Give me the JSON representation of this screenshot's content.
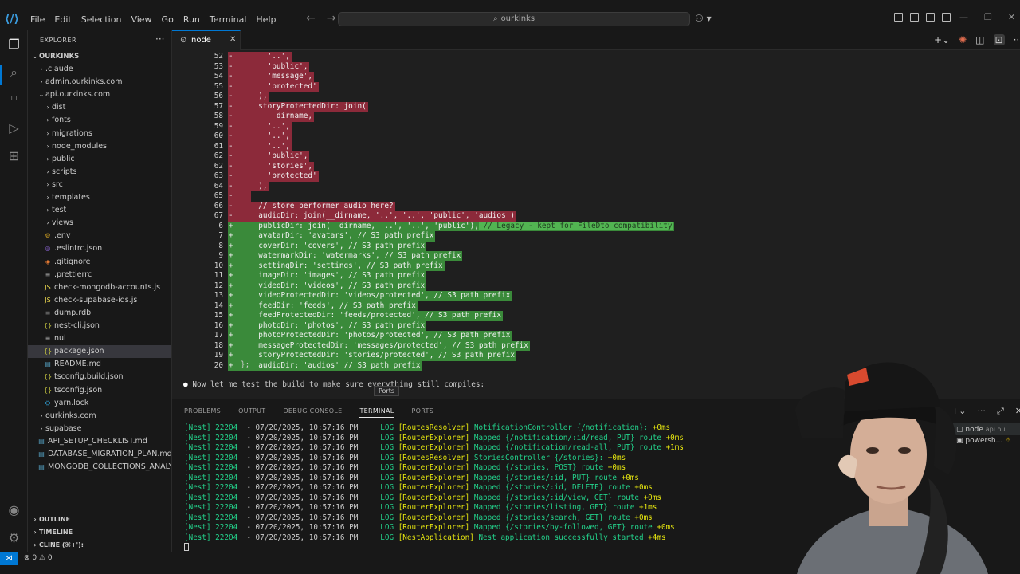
{
  "titlebar": {
    "menu": [
      "File",
      "Edit",
      "Selection",
      "View",
      "Go",
      "Run",
      "Terminal",
      "Help"
    ],
    "search_text": "ourkinks"
  },
  "sidebar": {
    "header": "EXPLORER",
    "root": "OURKINKS",
    "items": [
      {
        "label": ".claude",
        "type": "folder",
        "depth": 1
      },
      {
        "label": "admin.ourkinks.com",
        "type": "folder",
        "depth": 1
      },
      {
        "label": "api.ourkinks.com",
        "type": "folder-open",
        "depth": 1
      },
      {
        "label": "dist",
        "type": "folder",
        "depth": 2
      },
      {
        "label": "fonts",
        "type": "folder",
        "depth": 2
      },
      {
        "label": "migrations",
        "type": "folder",
        "depth": 2
      },
      {
        "label": "node_modules",
        "type": "folder",
        "depth": 2
      },
      {
        "label": "public",
        "type": "folder",
        "depth": 2
      },
      {
        "label": "scripts",
        "type": "folder",
        "depth": 2
      },
      {
        "label": "src",
        "type": "folder",
        "depth": 2
      },
      {
        "label": "templates",
        "type": "folder",
        "depth": 2
      },
      {
        "label": "test",
        "type": "folder",
        "depth": 2
      },
      {
        "label": "views",
        "type": "folder",
        "depth": 2
      },
      {
        "label": ".env",
        "type": "file-gear",
        "depth": 2
      },
      {
        "label": ".eslintrc.json",
        "type": "file-eslint",
        "depth": 2
      },
      {
        "label": ".gitignore",
        "type": "file-git",
        "depth": 2
      },
      {
        "label": ".prettierrc",
        "type": "file-text",
        "depth": 2
      },
      {
        "label": "check-mongodb-accounts.js",
        "type": "file-js",
        "depth": 2
      },
      {
        "label": "check-supabase-ids.js",
        "type": "file-js",
        "depth": 2
      },
      {
        "label": "dump.rdb",
        "type": "file-text",
        "depth": 2
      },
      {
        "label": "nest-cli.json",
        "type": "file-json",
        "depth": 2
      },
      {
        "label": "nul",
        "type": "file-text",
        "depth": 2
      },
      {
        "label": "package.json",
        "type": "file-json",
        "depth": 2,
        "selected": true
      },
      {
        "label": "README.md",
        "type": "file-md",
        "depth": 2
      },
      {
        "label": "tsconfig.build.json",
        "type": "file-json",
        "depth": 2
      },
      {
        "label": "tsconfig.json",
        "type": "file-json",
        "depth": 2
      },
      {
        "label": "yarn.lock",
        "type": "file-yarn",
        "depth": 2
      },
      {
        "label": "ourkinks.com",
        "type": "folder",
        "depth": 1
      },
      {
        "label": "supabase",
        "type": "folder",
        "depth": 1
      },
      {
        "label": "API_SETUP_CHECKLIST.md",
        "type": "file-md",
        "depth": 1
      },
      {
        "label": "DATABASE_MIGRATION_PLAN.md",
        "type": "file-md",
        "depth": 1
      },
      {
        "label": "MONGODB_COLLECTIONS_ANALY...",
        "type": "file-md",
        "depth": 1
      }
    ],
    "sections": [
      "OUTLINE",
      "TIMELINE",
      "CLINE (⌘+'):"
    ]
  },
  "tab": {
    "label": "node"
  },
  "diff": [
    {
      "ln": "52",
      "kind": "del",
      "code": "    '..',"
    },
    {
      "ln": "53",
      "kind": "del",
      "code": "    'public',"
    },
    {
      "ln": "54",
      "kind": "del",
      "code": "    'message',"
    },
    {
      "ln": "55",
      "kind": "del",
      "code": "    'protected'"
    },
    {
      "ln": "56",
      "kind": "del",
      "code": "  ),"
    },
    {
      "ln": "57",
      "kind": "del",
      "code": "  storyProtectedDir: join("
    },
    {
      "ln": "58",
      "kind": "del",
      "code": "    __dirname,"
    },
    {
      "ln": "59",
      "kind": "del",
      "code": "    '..',"
    },
    {
      "ln": "60",
      "kind": "del",
      "code": "    '..',"
    },
    {
      "ln": "61",
      "kind": "del",
      "code": "    '..',"
    },
    {
      "ln": "62",
      "kind": "del",
      "code": "    'public',"
    },
    {
      "ln": "62",
      "kind": "del",
      "code": "    'stories',"
    },
    {
      "ln": "63",
      "kind": "del",
      "code": "    'protected'"
    },
    {
      "ln": "64",
      "kind": "del",
      "code": "  ),"
    },
    {
      "ln": "65",
      "kind": "del",
      "code": ""
    },
    {
      "ln": "66",
      "kind": "del",
      "code": "  // store performer audio here?"
    },
    {
      "ln": "67",
      "kind": "del",
      "code": "  audioDir: join(__dirname, '..', '..', 'public', 'audios')"
    },
    {
      "ln": "6",
      "kind": "add",
      "code": "  publicDir: join(__dirname, '..', '..', 'public'),",
      "highlight": " // Legacy - kept for FileDto compatibility"
    },
    {
      "ln": "7",
      "kind": "add",
      "code": "  avatarDir: 'avatars', // S3 path prefix"
    },
    {
      "ln": "8",
      "kind": "add",
      "code": "  coverDir: 'covers', // S3 path prefix"
    },
    {
      "ln": "9",
      "kind": "add",
      "code": "  watermarkDir: 'watermarks', // S3 path prefix"
    },
    {
      "ln": "10",
      "kind": "add",
      "code": "  settingDir: 'settings', // S3 path prefix"
    },
    {
      "ln": "11",
      "kind": "add",
      "code": "  imageDir: 'images', // S3 path prefix"
    },
    {
      "ln": "12",
      "kind": "add",
      "code": "  videoDir: 'videos', // S3 path prefix"
    },
    {
      "ln": "13",
      "kind": "add",
      "code": "  videoProtectedDir: 'videos/protected', // S3 path prefix"
    },
    {
      "ln": "14",
      "kind": "add",
      "code": "  feedDir: 'feeds', // S3 path prefix"
    },
    {
      "ln": "15",
      "kind": "add",
      "code": "  feedProtectedDir: 'feeds/protected', // S3 path prefix"
    },
    {
      "ln": "16",
      "kind": "add",
      "code": "  photoDir: 'photos', // S3 path prefix"
    },
    {
      "ln": "17",
      "kind": "add",
      "code": "  photoProtectedDir: 'photos/protected', // S3 path prefix"
    },
    {
      "ln": "18",
      "kind": "add",
      "code": "  messageProtectedDir: 'messages/protected', // S3 path prefix"
    },
    {
      "ln": "19",
      "kind": "add",
      "code": "  storyProtectedDir: 'stories/protected', // S3 path prefix"
    },
    {
      "ln": "20",
      "kind": "add",
      "code": "  audioDir: 'audios' // S3 path prefix"
    }
  ],
  "closing": "};",
  "build_message": "Now let me test the build to make sure everything still compiles:",
  "tooltip": "Ports",
  "panel": {
    "tabs": [
      "PROBLEMS",
      "OUTPUT",
      "DEBUG CONSOLE",
      "TERMINAL",
      "PORTS"
    ],
    "active_tab": "TERMINAL",
    "terminals": [
      {
        "label": "node",
        "sub": "api.ou..."
      },
      {
        "label": "powersh...",
        "sub": ""
      }
    ],
    "log": [
      {
        "ctx": "[RoutesResolver]",
        "msg": "NotificationController {/notification}:",
        "time": "+0ms"
      },
      {
        "ctx": "[RouterExplorer]",
        "msg": "Mapped {/notification/:id/read, PUT} route",
        "time": "+0ms"
      },
      {
        "ctx": "[RouterExplorer]",
        "msg": "Mapped {/notification/read-all, PUT} route",
        "time": "+1ms"
      },
      {
        "ctx": "[RoutesResolver]",
        "msg": "StoriesController {/stories}:",
        "time": "+0ms"
      },
      {
        "ctx": "[RouterExplorer]",
        "msg": "Mapped {/stories, POST} route",
        "time": "+0ms"
      },
      {
        "ctx": "[RouterExplorer]",
        "msg": "Mapped {/stories/:id, PUT} route",
        "time": "+0ms"
      },
      {
        "ctx": "[RouterExplorer]",
        "msg": "Mapped {/stories/:id, DELETE} route",
        "time": "+0ms"
      },
      {
        "ctx": "[RouterExplorer]",
        "msg": "Mapped {/stories/:id/view, GET} route",
        "time": "+0ms"
      },
      {
        "ctx": "[RouterExplorer]",
        "msg": "Mapped {/stories/listing, GET} route",
        "time": "+1ms"
      },
      {
        "ctx": "[RouterExplorer]",
        "msg": "Mapped {/stories/search, GET} route",
        "time": "+0ms"
      },
      {
        "ctx": "[RouterExplorer]",
        "msg": "Mapped {/stories/by-followed, GET} route",
        "time": "+0ms"
      },
      {
        "ctx": "[NestApplication]",
        "msg": "Nest application successfully started",
        "time": "+4ms"
      }
    ],
    "log_prefix": "[Nest] 22204  - 07/20/2025, 10:57:16 PM     LOG"
  },
  "statusbar": {
    "problems": "⊗ 0 ⚠ 0"
  }
}
